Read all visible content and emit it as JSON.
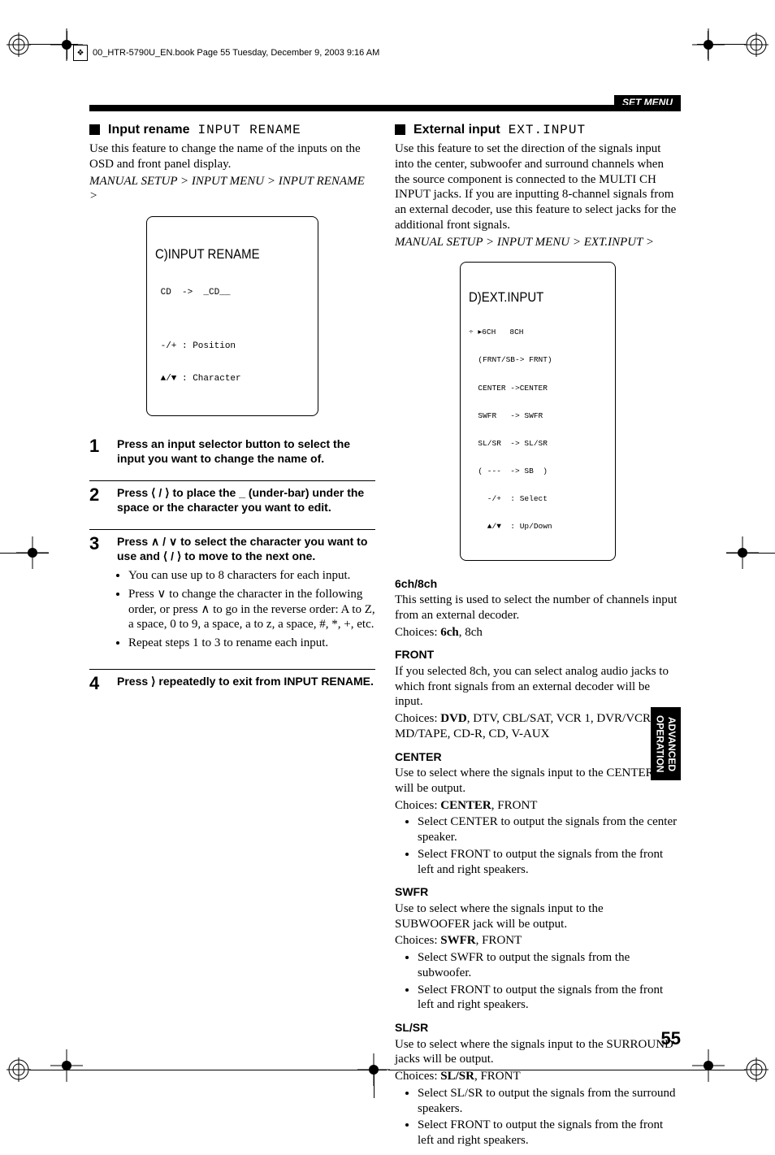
{
  "header": {
    "filename_line": "00_HTR-5790U_EN.book  Page 55  Tuesday, December 9, 2003  9:16 AM"
  },
  "set_menu": "SET MENU",
  "left": {
    "section_title": "Input rename",
    "osd_label": "INPUT RENAME",
    "intro": "Use this feature to change the name of the inputs on the OSD and front panel display.",
    "breadcrumb": "MANUAL SETUP > INPUT MENU > INPUT RENAME >",
    "lcd": {
      "title": "C)INPUT RENAME",
      "line1": " CD  ->  _CD__",
      "line2": "",
      "line3": " -/+ : Position",
      "line4": " ▲/▼ : Character"
    },
    "steps": [
      {
        "num": "1",
        "text": "Press an input selector button to select the input you want to change the name of."
      },
      {
        "num": "2",
        "text": "Press ⟨ / ⟩ to place the _ (under-bar) under the space or the character you want to edit."
      },
      {
        "num": "3",
        "text": "Press ∧ / ∨ to select the character you want to use and ⟨ / ⟩ to move to the next one.",
        "sub": [
          "You can use up to 8 characters for each input.",
          "Press ∨ to change the character in the following order, or press ∧ to go in the reverse order: A to Z, a space, 0 to 9, a space, a to z, a space, #, *, +, etc.",
          "Repeat steps 1 to 3 to rename each input."
        ]
      },
      {
        "num": "4",
        "text": "Press ⟩ repeatedly to exit from INPUT RENAME."
      }
    ]
  },
  "right": {
    "section_title": "External input",
    "osd_label": "EXT.INPUT",
    "intro": "Use this feature to set the direction of the signals input into the center, subwoofer and surround channels when the source component is connected to the MULTI CH INPUT jacks. If you are inputting 8-channel signals from an external decoder, use this feature to select jacks for the additional front signals.",
    "breadcrumb": "MANUAL SETUP > INPUT MENU > EXT.INPUT >",
    "lcd": {
      "title": "D)EXT.INPUT",
      "line1": "÷ ▸6CH   8CH",
      "line2": "  (FRNT/SB-> FRNT)",
      "line3": "  CENTER ->CENTER",
      "line4": "  SWFR   -> SWFR",
      "line5": "  SL/SR  -> SL/SR",
      "line6": "  ( ---  -> SB  )",
      "line7": "    -/+  : Select",
      "line8": "    ▲/▼  : Up/Down"
    },
    "sub1": {
      "title": "6ch/8ch",
      "text": "This setting is used to select the number of channels input from an external decoder.",
      "choices_prefix": "Choices: ",
      "choices_bold": "6ch",
      "choices_rest": ", 8ch"
    },
    "sub2": {
      "title": "FRONT",
      "text": "If you selected 8ch, you can select analog audio jacks to which front signals from an external decoder will be input.",
      "choices_prefix": "Choices: ",
      "choices_bold": "DVD",
      "choices_rest": ", DTV, CBL/SAT, VCR 1, DVR/VCR 2, MD/TAPE, CD-R, CD, V-AUX"
    },
    "sub3": {
      "title": "CENTER",
      "text": "Use to select where the signals input to the CENTER jack will be output.",
      "choices_prefix": "Choices: ",
      "choices_bold": "CENTER",
      "choices_rest": ", FRONT",
      "bullets": [
        "Select CENTER to output the signals from the center speaker.",
        "Select FRONT to output the signals from the front left and right speakers."
      ]
    },
    "sub4": {
      "title": "SWFR",
      "text": "Use to select where the signals input to the SUBWOOFER jack will be output.",
      "choices_prefix": "Choices: ",
      "choices_bold": "SWFR",
      "choices_rest": ", FRONT",
      "bullets": [
        "Select SWFR to output the signals from the subwoofer.",
        "Select FRONT to output the signals from the front left and right speakers."
      ]
    },
    "sub5": {
      "title": "SL/SR",
      "text": "Use to select where the signals input to the SURROUND jacks will be output.",
      "choices_prefix": "Choices: ",
      "choices_bold": "SL/SR",
      "choices_rest": ", FRONT",
      "bullets": [
        "Select SL/SR to output the signals from the surround speakers.",
        "Select FRONT to output the signals from the front left and right speakers."
      ]
    }
  },
  "side_tab": "ADVANCED\nOPERATION",
  "page_number": "55"
}
